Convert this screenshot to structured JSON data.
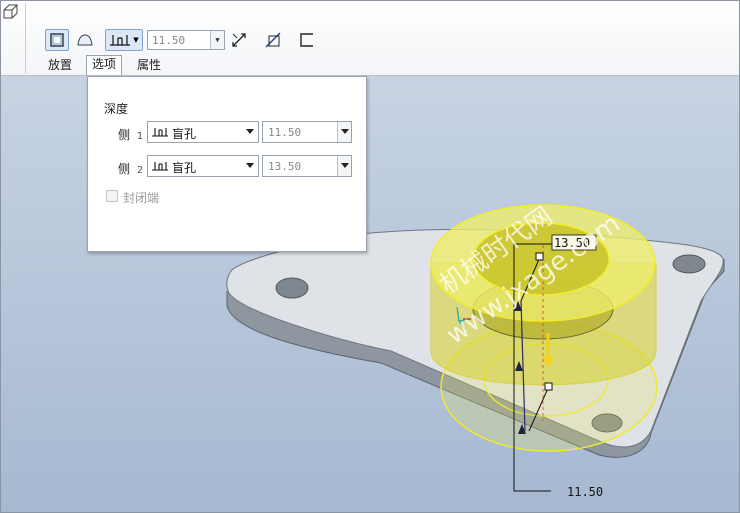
{
  "toolbar": {
    "depth_value": "11.50",
    "tabs": [
      "放置",
      "选项",
      "属性"
    ]
  },
  "options_panel": {
    "depth_label": "深度",
    "side1": {
      "label": "侧",
      "num": "1",
      "type": "盲孔",
      "value": "11.50"
    },
    "side2": {
      "label": "侧",
      "num": "2",
      "type": "盲孔",
      "value": "13.50"
    },
    "capped_ends_label": "封闭端"
  },
  "viewport": {
    "dimension_top": "13.50",
    "dimension_bottom": "11.50",
    "watermark_cn": "机械时代网",
    "watermark_url": "www.jxage.com"
  },
  "colors": {
    "viewport_top": "#c7d3e3",
    "viewport_bottom": "#a6b9d1",
    "preview_yellow": "#e6e35a",
    "plate": "#dfe3e7"
  }
}
